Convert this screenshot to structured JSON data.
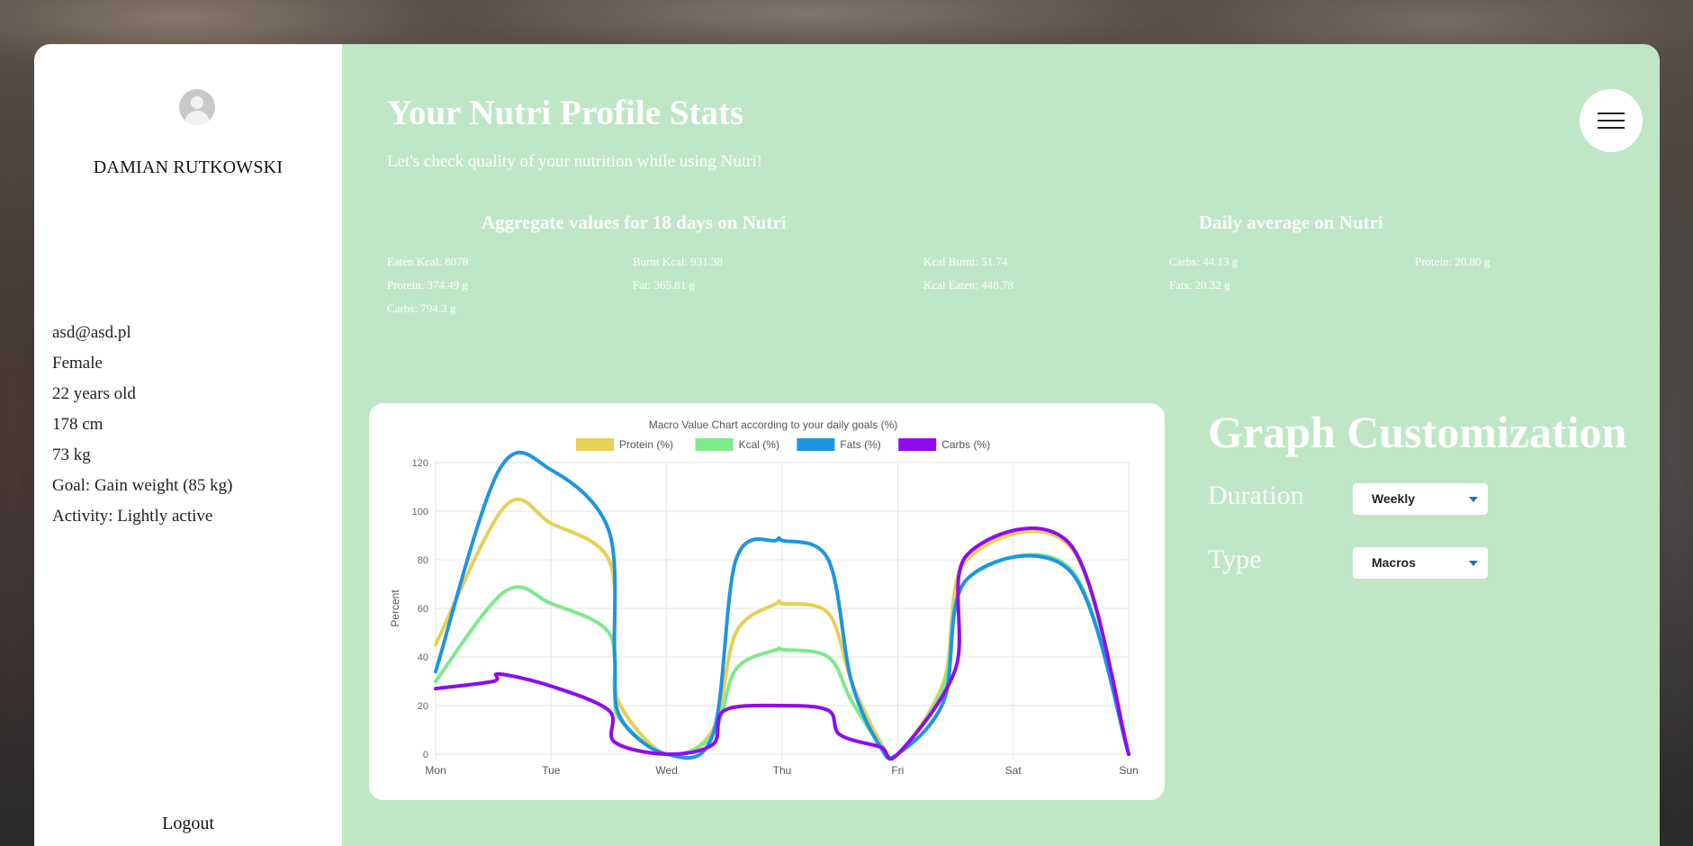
{
  "profile": {
    "name": "DAMIAN RUTKOWSKI",
    "email": "asd@asd.pl",
    "gender": "Female",
    "age": "22 years old",
    "height": "178 cm",
    "weight": "73 kg",
    "goal": "Goal: Gain weight (85 kg)",
    "activity": "Activity: Lightly active",
    "logout_label": "Logout"
  },
  "header": {
    "title": "Your Nutri Profile Stats",
    "subtitle": "Let's check quality of your nutrition while using Nutri!"
  },
  "aggregate": {
    "heading": "Aggregate values for 18 days on Nutri",
    "eaten_kcal": "Eaten Kcal: 8078",
    "burnt_kcal": "Burnt Kcal: 931.38",
    "protein": "Protein: 374.49 g",
    "fat": "Fat: 365.81 g",
    "carbs": "Carbs: 794.3 g"
  },
  "daily": {
    "heading": "Daily average on Nutri",
    "kcal_burnt": "Kcal Burnt: 51.74",
    "kcal_eaten": "Kcal Eaten: 448.78",
    "carbs": "Carbs: 44.13 g",
    "fats": "Fats: 20.32 g",
    "protein": "Protein: 20.80 g"
  },
  "customization": {
    "title": "Graph Customization",
    "duration_label": "Duration",
    "duration_value": "Weekly",
    "type_label": "Type",
    "type_value": "Macros"
  },
  "colors": {
    "main_bg": "#bfe7c5",
    "protein": "#e8cf55",
    "kcal": "#7eea8a",
    "fats": "#1e94e3",
    "carbs": "#8f0cf0"
  },
  "chart_data": {
    "type": "line",
    "title": "Macro Value Chart according to your daily goals (%)",
    "ylabel": "Percent",
    "xlabel": "",
    "categories": [
      "Mon",
      "Tue",
      "Wed",
      "Thu",
      "Fri",
      "Sat",
      "Sun"
    ],
    "ylim": [
      0,
      120
    ],
    "yticks": [
      0,
      20,
      40,
      60,
      80,
      100,
      120
    ],
    "legend_position": "top",
    "grid": true,
    "series": [
      {
        "name": "Protein (%)",
        "color": "#e8cf55",
        "x": [
          0,
          0.6,
          1,
          1.5,
          1.55,
          1.6,
          2,
          2.4,
          2.6,
          2.95,
          3,
          3.4,
          3.6,
          3.85,
          4,
          4.4,
          4.6,
          5.5,
          6
        ],
        "y": [
          45,
          102,
          95,
          80,
          40,
          20,
          0,
          10,
          50,
          62,
          62,
          58,
          30,
          5,
          0,
          30,
          80,
          85,
          0
        ]
      },
      {
        "name": "Kcal (%)",
        "color": "#7eea8a",
        "x": [
          0,
          0.6,
          1,
          1.5,
          1.55,
          1.6,
          2,
          2.4,
          2.6,
          2.95,
          3,
          3.4,
          3.6,
          3.85,
          4,
          4.4,
          4.6,
          5.5,
          6
        ],
        "y": [
          30,
          67,
          62,
          50,
          25,
          14,
          0,
          8,
          35,
          43,
          43,
          40,
          22,
          4,
          0,
          28,
          72,
          76,
          0
        ]
      },
      {
        "name": "Fats (%)",
        "color": "#1e94e3",
        "x": [
          0,
          0.55,
          1,
          1.5,
          1.55,
          1.6,
          2,
          2.4,
          2.6,
          2.95,
          3,
          3.4,
          3.6,
          3.85,
          4,
          4.4,
          4.6,
          5.5,
          6
        ],
        "y": [
          34,
          117,
          117,
          92,
          40,
          15,
          0,
          8,
          80,
          88,
          88,
          80,
          30,
          3,
          0,
          22,
          72,
          75,
          0
        ]
      },
      {
        "name": "Carbs (%)",
        "color": "#8f0cf0",
        "x": [
          0,
          0.5,
          0.55,
          1,
          1.5,
          1.55,
          2,
          2.4,
          2.5,
          3,
          3.4,
          3.5,
          3.85,
          4,
          4.5,
          4.6,
          5.5,
          6
        ],
        "y": [
          27,
          30,
          33,
          28,
          18,
          5,
          0,
          4,
          18,
          20,
          18,
          8,
          3,
          0,
          35,
          82,
          86,
          0
        ]
      }
    ]
  }
}
